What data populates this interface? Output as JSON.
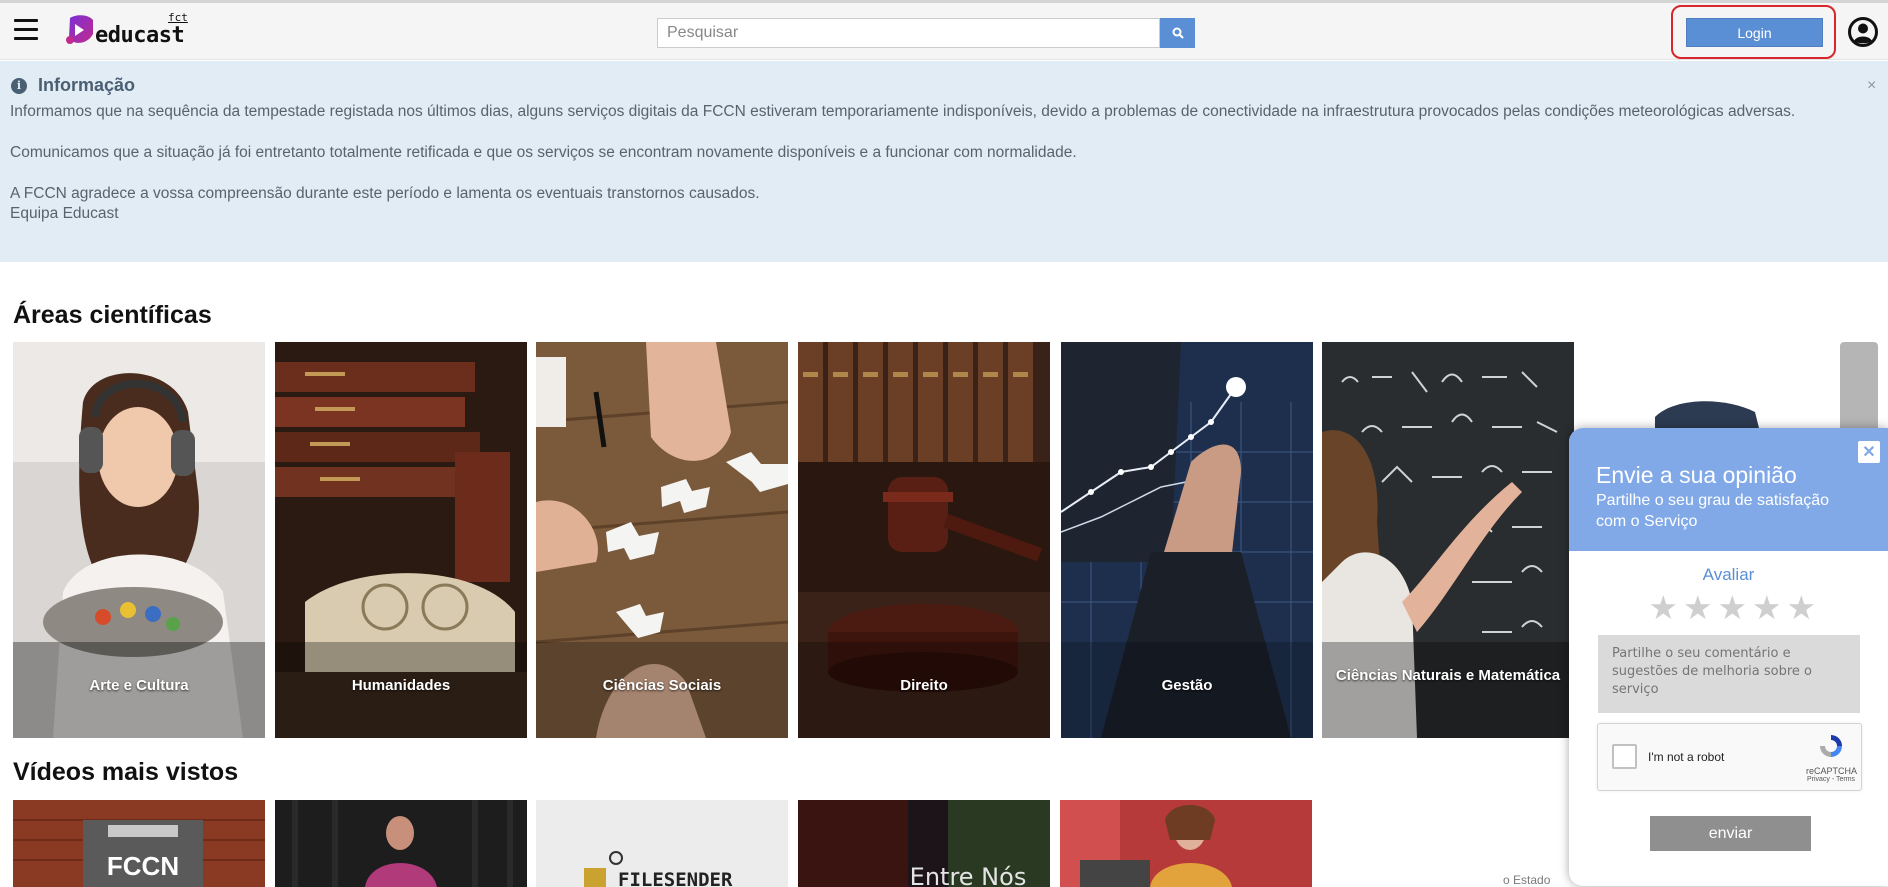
{
  "header": {
    "logo_text": "educast",
    "logo_superscript": "fct",
    "search_placeholder": "Pesquisar",
    "login_label": "Login"
  },
  "info": {
    "title": "Informação",
    "close": "×",
    "line1": "Informamos que na sequência da tempestade registada nos últimos dias, alguns serviços digitais da FCCN estiveram temporariamente indisponíveis, devido a problemas de conectividade na infraestrutura provocados pelas condições meteorológicas adversas.",
    "line2": "Comunicamos que a situação já foi entretanto totalmente retificada e que os serviços se encontram novamente disponíveis e a funcionar com normalidade.",
    "line3": "A FCCN agradece a vossa compreensão durante este período e lamenta os eventuais transtornos causados.",
    "line4": "Equipa Educast"
  },
  "areas": {
    "title": "Áreas científicas",
    "cards": [
      {
        "label": "Arte e Cultura"
      },
      {
        "label": "Humanidades"
      },
      {
        "label": "Ciências Sociais"
      },
      {
        "label": "Direito"
      },
      {
        "label": "Gestão"
      },
      {
        "label": "Ciências Naturais e Matemática"
      }
    ]
  },
  "videos": {
    "title": "Vídeos mais vistos",
    "thumb1_text": "FCCN",
    "thumb3_text": "FILESENDER",
    "thumb4_text": "Entre Nós",
    "partial_text": "o Estado"
  },
  "feedback": {
    "title": "Envie a sua opinião",
    "subtitle": "Partilhe o seu grau de satisfação com o Serviço",
    "close": "✕",
    "rate_label": "Avaliar",
    "stars": 5,
    "rating": 0,
    "comment_placeholder": "Partilhe o seu comentário e sugestões de melhoria sobre o serviço",
    "captcha_label": "I'm not a robot",
    "captcha_brand": "reCAPTCHA",
    "captcha_links": "Privacy - Terms",
    "send_label": "enviar"
  },
  "colors": {
    "accent": "#5b8fd5",
    "info_bg": "#e1ecf4",
    "feedback_head": "#81a9e8",
    "login_outline": "#d8262b"
  }
}
